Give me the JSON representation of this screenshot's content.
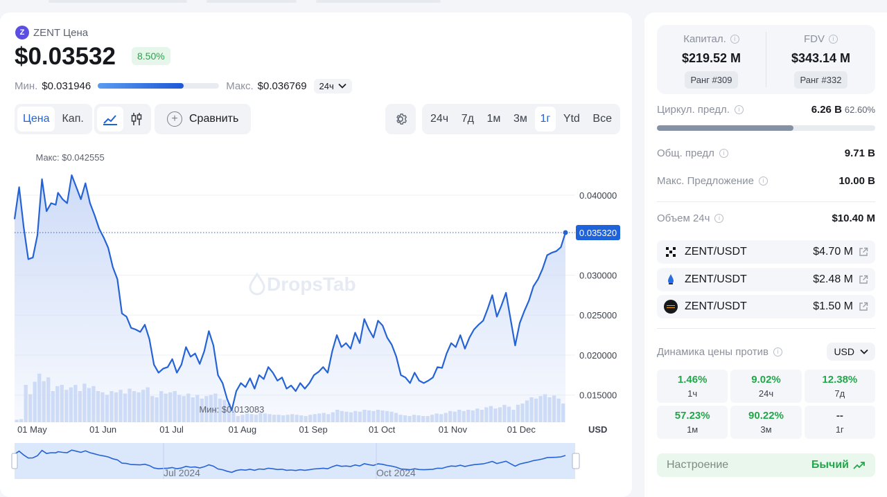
{
  "header": {
    "token_title": "ZENT Цена",
    "price": "$0.03532",
    "change_pct": "8.50%",
    "min_label": "Мин.",
    "min_value": "$0.031946",
    "max_label": "Макс.",
    "max_value": "$0.036769",
    "range_position": 0.71,
    "range_period": "24ч"
  },
  "toolbar": {
    "mode_tabs": [
      "Цена",
      "Кап."
    ],
    "active_mode": "Цена",
    "compare_label": "Сравнить",
    "timeframes": [
      "24ч",
      "7д",
      "1м",
      "3м",
      "1г",
      "Ytd",
      "Все"
    ],
    "active_timeframe": "1г"
  },
  "chart_data": {
    "type": "line",
    "x_tick_labels": [
      "01 May",
      "01 Jun",
      "01 Jul",
      "01 Aug",
      "01 Sep",
      "01 Oct",
      "01 Nov",
      "01 Dec"
    ],
    "y_tick_labels": [
      "0.040000",
      "0.030000",
      "0.025000",
      "0.020000",
      "0.015000"
    ],
    "y_ticks": [
      0.04,
      0.03,
      0.025,
      0.02,
      0.015
    ],
    "ylim": [
      0.0116,
      0.0445
    ],
    "y_unit": "USD",
    "current_value": 0.03532,
    "current_label": "0.035320",
    "max_annotation": "Макс: $0.042555",
    "min_annotation": "Мин: $0.013083",
    "watermark": "DropsTab",
    "grid": true,
    "x_start": "2024-04-23",
    "x_end": "2024-12-20",
    "series": [
      {
        "x": [
          "2024-04-23",
          "2024-04-25",
          "2024-04-27",
          "2024-04-29",
          "2024-05-01",
          "2024-05-03",
          "2024-05-05",
          "2024-05-07",
          "2024-05-09",
          "2024-05-11",
          "2024-05-12",
          "2024-05-14",
          "2024-05-16",
          "2024-05-18",
          "2024-05-20",
          "2024-05-22",
          "2024-05-24",
          "2024-05-26",
          "2024-05-28",
          "2024-05-30",
          "2024-06-01",
          "2024-06-03",
          "2024-06-05",
          "2024-06-07",
          "2024-06-09",
          "2024-06-11",
          "2024-06-13",
          "2024-06-15",
          "2024-06-17",
          "2024-06-19",
          "2024-06-21",
          "2024-06-23",
          "2024-06-25",
          "2024-06-27",
          "2024-06-29",
          "2024-07-01",
          "2024-07-03",
          "2024-07-05",
          "2024-07-07",
          "2024-07-09",
          "2024-07-11",
          "2024-07-13",
          "2024-07-15",
          "2024-07-17",
          "2024-07-19",
          "2024-07-21",
          "2024-07-23",
          "2024-07-25",
          "2024-07-27",
          "2024-07-29",
          "2024-07-31",
          "2024-08-02",
          "2024-08-04",
          "2024-08-06",
          "2024-08-08",
          "2024-08-10",
          "2024-08-12",
          "2024-08-14",
          "2024-08-16",
          "2024-08-18",
          "2024-08-20",
          "2024-08-22",
          "2024-08-24",
          "2024-08-26",
          "2024-08-28",
          "2024-08-30",
          "2024-09-01",
          "2024-09-03",
          "2024-09-05",
          "2024-09-07",
          "2024-09-09",
          "2024-09-11",
          "2024-09-13",
          "2024-09-15",
          "2024-09-17",
          "2024-09-19",
          "2024-09-21",
          "2024-09-23",
          "2024-09-25",
          "2024-09-27",
          "2024-09-29",
          "2024-10-01",
          "2024-10-03",
          "2024-10-05",
          "2024-10-07",
          "2024-10-09",
          "2024-10-11",
          "2024-10-13",
          "2024-10-15",
          "2024-10-17",
          "2024-10-19",
          "2024-10-21",
          "2024-10-23",
          "2024-10-25",
          "2024-10-27",
          "2024-10-29",
          "2024-10-31",
          "2024-11-02",
          "2024-11-04",
          "2024-11-06",
          "2024-11-08",
          "2024-11-10",
          "2024-11-12",
          "2024-11-14",
          "2024-11-16",
          "2024-11-18",
          "2024-11-20",
          "2024-11-22",
          "2024-11-24",
          "2024-11-26",
          "2024-11-28",
          "2024-11-30",
          "2024-12-02",
          "2024-12-04",
          "2024-12-06",
          "2024-12-08",
          "2024-12-10",
          "2024-12-12",
          "2024-12-14",
          "2024-12-16",
          "2024-12-18",
          "2024-12-20"
        ],
        "y": [
          0.037,
          0.041,
          0.036,
          0.032,
          0.0322,
          0.035,
          0.042,
          0.038,
          0.039,
          0.0388,
          0.0403,
          0.0395,
          0.039,
          0.0425,
          0.041,
          0.0395,
          0.0415,
          0.039,
          0.0375,
          0.0358,
          0.0347,
          0.0334,
          0.031,
          0.0295,
          0.0252,
          0.0248,
          0.0234,
          0.0232,
          0.0229,
          0.0238,
          0.022,
          0.0188,
          0.0178,
          0.0183,
          0.0185,
          0.0195,
          0.0178,
          0.0188,
          0.021,
          0.0198,
          0.0202,
          0.0189,
          0.0205,
          0.023,
          0.0212,
          0.0175,
          0.0165,
          0.0145,
          0.0131,
          0.0155,
          0.0165,
          0.016,
          0.0171,
          0.0158,
          0.0175,
          0.017,
          0.0185,
          0.0178,
          0.0168,
          0.0172,
          0.0158,
          0.0162,
          0.0155,
          0.0165,
          0.0158,
          0.0165,
          0.0175,
          0.0179,
          0.0185,
          0.0178,
          0.0205,
          0.0225,
          0.021,
          0.0215,
          0.0208,
          0.0228,
          0.0215,
          0.0245,
          0.0232,
          0.0222,
          0.0243,
          0.0237,
          0.0222,
          0.0213,
          0.0198,
          0.0175,
          0.0172,
          0.0165,
          0.0178,
          0.0168,
          0.0165,
          0.0168,
          0.0172,
          0.0185,
          0.0184,
          0.0202,
          0.0215,
          0.021,
          0.0225,
          0.0208,
          0.0222,
          0.0232,
          0.0238,
          0.0243,
          0.0258,
          0.0275,
          0.0248,
          0.0262,
          0.0278,
          0.0245,
          0.0212,
          0.024,
          0.0255,
          0.0268,
          0.0286,
          0.0295,
          0.0308,
          0.0325,
          0.0328,
          0.033,
          0.0335,
          0.03532
        ]
      }
    ],
    "volume": {
      "note": "volume bars shown on a separate relative scale",
      "values": [
        0.04,
        0.05,
        0.6,
        0.45,
        0.65,
        0.78,
        0.66,
        0.72,
        0.5,
        0.58,
        0.6,
        0.52,
        0.56,
        0.6,
        0.5,
        0.62,
        0.55,
        0.58,
        0.5,
        0.48,
        0.44,
        0.5,
        0.48,
        0.52,
        0.46,
        0.54,
        0.5,
        0.48,
        0.52,
        0.56,
        0.42,
        0.4,
        0.5,
        0.46,
        0.48,
        0.5,
        0.44,
        0.42,
        0.46,
        0.4,
        0.44,
        0.38,
        0.42,
        0.44,
        0.46,
        0.38,
        0.36,
        0.3,
        0.2,
        0.1,
        0.12,
        0.14,
        0.13,
        0.12,
        0.15,
        0.14,
        0.13,
        0.12,
        0.12,
        0.11,
        0.12,
        0.13,
        0.12,
        0.11,
        0.1,
        0.12,
        0.13,
        0.14,
        0.15,
        0.13,
        0.16,
        0.2,
        0.18,
        0.17,
        0.16,
        0.18,
        0.17,
        0.2,
        0.19,
        0.18,
        0.2,
        0.19,
        0.18,
        0.17,
        0.15,
        0.12,
        0.11,
        0.1,
        0.12,
        0.11,
        0.1,
        0.1,
        0.12,
        0.14,
        0.13,
        0.15,
        0.18,
        0.17,
        0.2,
        0.18,
        0.2,
        0.19,
        0.22,
        0.2,
        0.24,
        0.26,
        0.22,
        0.24,
        0.28,
        0.25,
        0.2,
        0.28,
        0.3,
        0.35,
        0.4,
        0.38,
        0.42,
        0.45,
        0.4,
        0.43,
        0.38,
        0.3
      ]
    },
    "navigator_labels": [
      "Jul 2024",
      "Oct 2024"
    ]
  },
  "market": {
    "cap_label": "Капитал.",
    "cap_value": "$219.52 M",
    "cap_rank": "Ранг #309",
    "fdv_label": "FDV",
    "fdv_value": "$343.14 M",
    "fdv_rank": "Ранг #332",
    "circ_label": "Циркул. предл.",
    "circ_value": "6.26 B",
    "circ_pct": "62.60%",
    "circ_fraction": 0.626,
    "total_label": "Общ. предл",
    "total_value": "9.71 B",
    "max_label": "Макс. Предложение",
    "max_value": "10.00 B",
    "vol_label": "Объем 24ч",
    "vol_value": "$10.40 M"
  },
  "pairs": [
    {
      "exchange_icon": "okx-logo-icon",
      "pair": "ZENT/USDT",
      "volume": "$4.70 M"
    },
    {
      "exchange_icon": "upbit-drop-logo-icon",
      "pair": "ZENT/USDT",
      "volume": "$2.48 M"
    },
    {
      "exchange_icon": "bybit-logo-icon",
      "pair": "ZENT/USDT",
      "volume": "$1.50 M"
    }
  ],
  "dynamics": {
    "label": "Динамика цены против",
    "currency": "USD",
    "cells": [
      {
        "pct": "1.46%",
        "period": "1ч"
      },
      {
        "pct": "9.02%",
        "period": "24ч"
      },
      {
        "pct": "12.38%",
        "period": "7д"
      },
      {
        "pct": "57.23%",
        "period": "1м"
      },
      {
        "pct": "90.22%",
        "period": "3м"
      },
      {
        "pct": "--",
        "period": "1г"
      }
    ]
  },
  "sentiment": {
    "label": "Настроение",
    "value": "Бычий"
  },
  "colors": {
    "accent": "#1f63db",
    "line": "#2563d4",
    "positive": "#23a64a",
    "fill_top": "#c9d8f7",
    "volume": "#cfdcf6"
  }
}
